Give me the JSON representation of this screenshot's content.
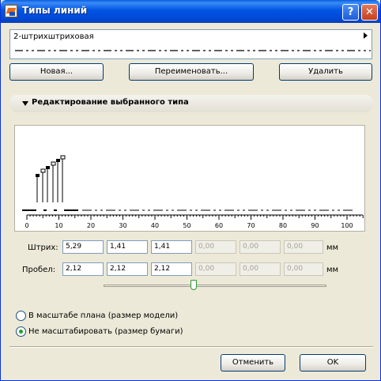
{
  "window": {
    "title": "Типы линий"
  },
  "titlebar_buttons": {
    "help": "?",
    "close": "✕"
  },
  "line_type": {
    "selected": "2-штрихштриховая"
  },
  "buttons": {
    "new": "Новая...",
    "rename": "Переименовать...",
    "delete": "Удалить",
    "cancel": "Отменить",
    "ok": "OK"
  },
  "section": {
    "title": "Редактирование выбранного типа"
  },
  "ruler": {
    "labels": [
      "0",
      "10",
      "20",
      "30",
      "40",
      "50",
      "60",
      "70",
      "80",
      "90",
      "100"
    ]
  },
  "dash": {
    "label": "Штрих:",
    "values": [
      "5,29",
      "1,41",
      "1,41",
      "0,00",
      "0,00",
      "0,00"
    ],
    "unit": "мм"
  },
  "gap": {
    "label": "Пробел:",
    "values": [
      "2,12",
      "2,12",
      "2,12",
      "0,00",
      "0,00",
      "0,00"
    ],
    "unit": "мм"
  },
  "scale": {
    "option_model": "В масштабе плана (размер модели)",
    "option_paper": "Не масштабировать (размер бумаги)",
    "selected": "paper"
  },
  "colors": {
    "title_bar": "#0054e3",
    "window_bg": "#ece9d8",
    "radio_dot": "#21a121",
    "slider": "#2d9a35"
  }
}
